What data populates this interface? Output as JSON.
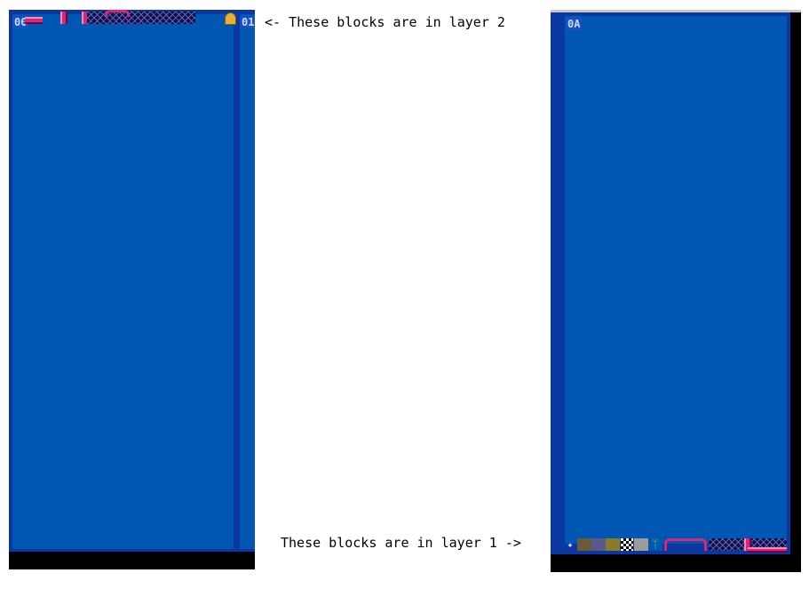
{
  "left_panel": {
    "screen_ids": [
      "00",
      "01"
    ],
    "background_color": "#0056b3",
    "frame_color": "#0a37a0"
  },
  "right_panel": {
    "screen_id": "0A",
    "background_color": "#0056b3",
    "frame_color": "#0a37a0"
  },
  "annotations": {
    "layer2_note": "<- These blocks are in layer 2",
    "layer1_note": "These blocks are in layer 1 ->"
  },
  "tiles": {
    "layer2_icons": [
      "pipe-corner-icon",
      "pipe-vertical-icon",
      "grid-block-icon",
      "pipe-arch-icon",
      "door-icon"
    ],
    "layer1_icons": [
      "gem-icon",
      "dirt-block-icon",
      "stone-block-icon",
      "olive-block-icon",
      "checker-block-icon",
      "gray-block-icon",
      "plant-icon",
      "pipe-arch-icon",
      "grid-block-icon",
      "pipe-vertical-icon"
    ]
  }
}
